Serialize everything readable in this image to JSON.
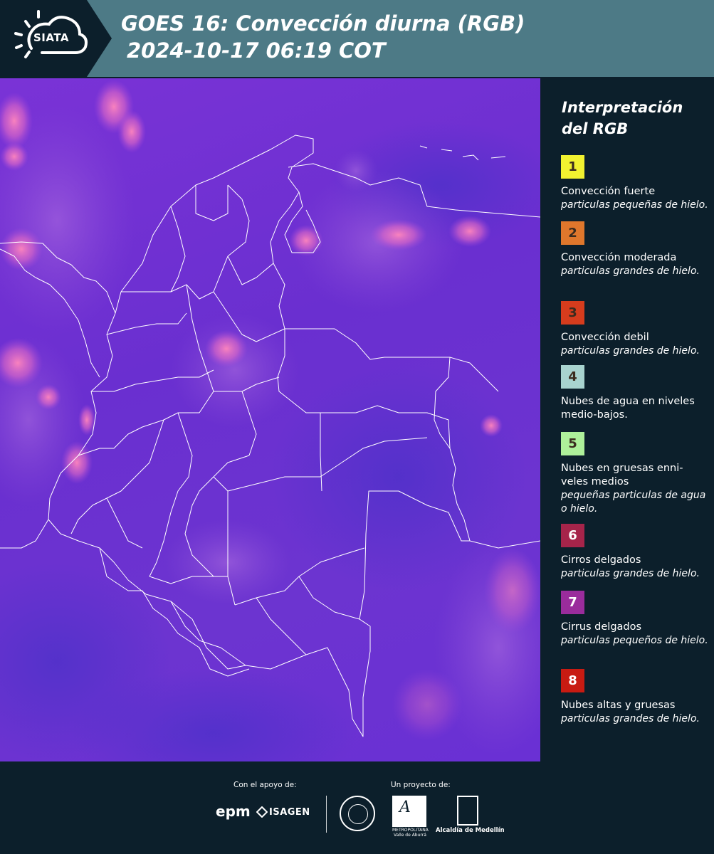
{
  "header": {
    "logo_text": "SIATA",
    "title_line1": "GOES 16: Convección diurna (RGB)",
    "title_line2": "2024-10-17 06:19 COT"
  },
  "legend": {
    "title": "Interpretación del RGB",
    "items": [
      {
        "num": "1",
        "color": "#f2f230",
        "title": "Convección fuerte",
        "subtitle": "particulas pequeñas de hielo."
      },
      {
        "num": "2",
        "color": "#e0772c",
        "title": "Convección moderada",
        "subtitle": "particulas grandes de hielo."
      },
      {
        "num": "3",
        "color": "#d63c1d",
        "title": "Convección debil",
        "subtitle": "particulas grandes de hielo."
      },
      {
        "num": "4",
        "color": "#a8d3cf",
        "title": "Nubes de agua en niveles medio-bajos.",
        "subtitle": ""
      },
      {
        "num": "5",
        "color": "#aef09a",
        "title": "Nubes en gruesas enni- veles medios",
        "subtitle": "pequeñas particulas de agua o hielo."
      },
      {
        "num": "6",
        "color": "#a6244a",
        "title": "Cirros delgados",
        "subtitle": "particulas grandes de hielo."
      },
      {
        "num": "7",
        "color": "#9a2c9c",
        "title": "Cirrus delgados",
        "subtitle": "particulas pequeños de hielo."
      },
      {
        "num": "8",
        "color": "#c81b12",
        "title": "Nubes altas y gruesas",
        "subtitle": "particulas grandes de hielo."
      }
    ]
  },
  "footer": {
    "support_label": "Con el apoyo de:",
    "project_label": "Un proyecto de:",
    "sponsor_1": "epm",
    "sponsor_2": "ISAGEN",
    "partner_amva_text": "METROPOLITANA Valle de Aburrá",
    "partner_alcaldia": "Alcaldía de Medellín"
  },
  "map": {
    "background_color": "#6c32d2",
    "cloud_color": "#f07ac0",
    "boundary_color": "#ffffff"
  }
}
